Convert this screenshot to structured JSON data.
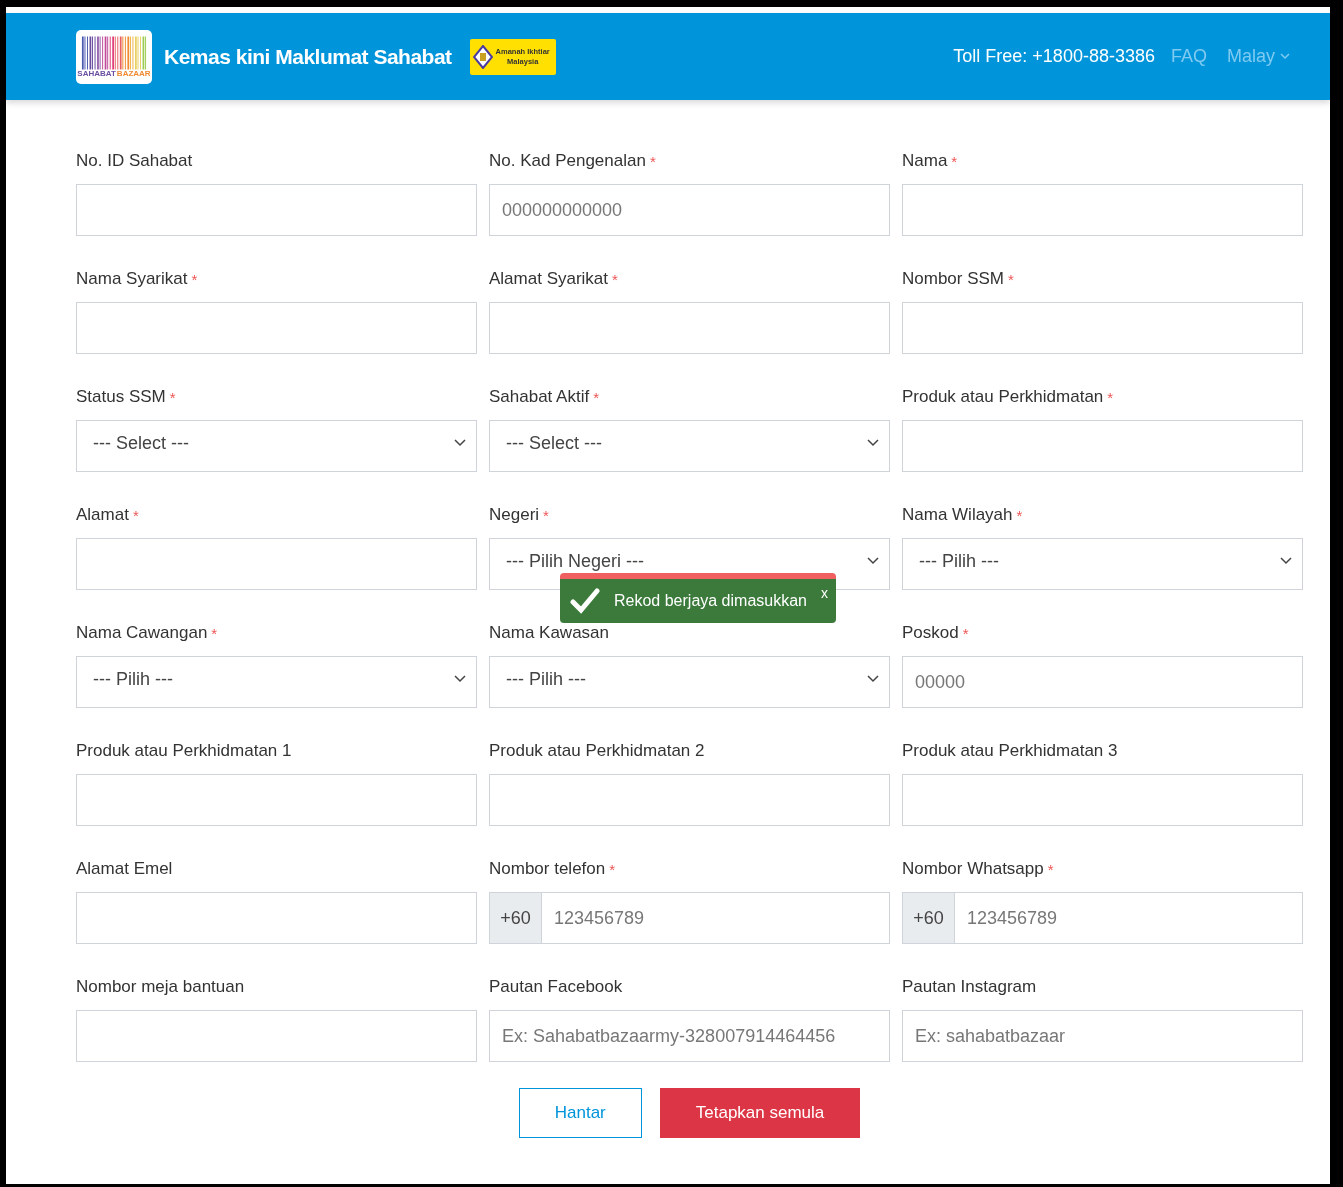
{
  "header": {
    "logo_text": [
      "SAHABAT",
      "BAZAAR"
    ],
    "title": "Kemas kini Maklumat Sahabat",
    "partner_logo_text": [
      "Amanah Ikhtiar",
      "Malaysia"
    ],
    "toll_free": "Toll Free: +1800-88-3386",
    "faq": "FAQ",
    "language": "Malay"
  },
  "fields": [
    {
      "label": "No. ID Sahabat",
      "kind": "text"
    },
    {
      "label": "No. Kad Pengenalan",
      "marker": "*",
      "kind": "text",
      "placeholder": "000000000000"
    },
    {
      "label": "Nama",
      "marker": "*",
      "kind": "text"
    },
    {
      "label": "Nama Syarikat",
      "marker": "*",
      "kind": "text"
    },
    {
      "label": "Alamat Syarikat",
      "marker": "*",
      "kind": "text"
    },
    {
      "label": "Nombor SSM",
      "marker": "*",
      "kind": "text"
    },
    {
      "label": "Status SSM",
      "marker": "*",
      "kind": "select",
      "value": "--- Select ---"
    },
    {
      "label": "Sahabat Aktif",
      "marker": "*",
      "kind": "select",
      "value": "--- Select ---"
    },
    {
      "label": "Produk atau Perkhidmatan",
      "marker": "*",
      "kind": "text"
    },
    {
      "label": "Alamat",
      "marker": "*",
      "kind": "text"
    },
    {
      "label": "Negeri",
      "marker": "*",
      "kind": "select",
      "value": "--- Pilih Negeri ---"
    },
    {
      "label": "Nama Wilayah",
      "marker": "*",
      "kind": "select",
      "value": "--- Pilih ---"
    },
    {
      "label": "Nama Cawangan",
      "marker": "*",
      "kind": "select",
      "value": "--- Pilih ---"
    },
    {
      "label": "Nama Kawasan",
      "kind": "select",
      "value": "--- Pilih ---"
    },
    {
      "label": "Poskod",
      "marker": "*",
      "kind": "text",
      "placeholder": "00000"
    },
    {
      "label": "Produk atau Perkhidmatan 1",
      "kind": "text"
    },
    {
      "label": "Produk atau Perkhidmatan 2",
      "kind": "text"
    },
    {
      "label": "Produk atau Perkhidmatan 3",
      "kind": "text"
    },
    {
      "label": "Alamat Emel",
      "kind": "text"
    },
    {
      "label": "Nombor telefon",
      "marker": "*",
      "kind": "phone",
      "prefix": "+60",
      "placeholder": "123456789"
    },
    {
      "label": "Nombor Whatsapp",
      "marker": "*",
      "kind": "phone",
      "prefix": "+60",
      "placeholder": "123456789"
    },
    {
      "label": "Nombor meja bantuan",
      "kind": "text"
    },
    {
      "label": "Pautan Facebook",
      "kind": "text",
      "placeholder": "Ex: Sahabatbazaarmy-328007914464456"
    },
    {
      "label": "Pautan Instagram",
      "kind": "text",
      "placeholder": "Ex: sahabatbazaar"
    }
  ],
  "buttons": [
    {
      "label": "Hantar",
      "kind": "outline"
    },
    {
      "label": "Tetapkan semula",
      "kind": "danger"
    }
  ],
  "toast": {
    "message": "Rekod berjaya dimasukkan",
    "close": "x"
  }
}
